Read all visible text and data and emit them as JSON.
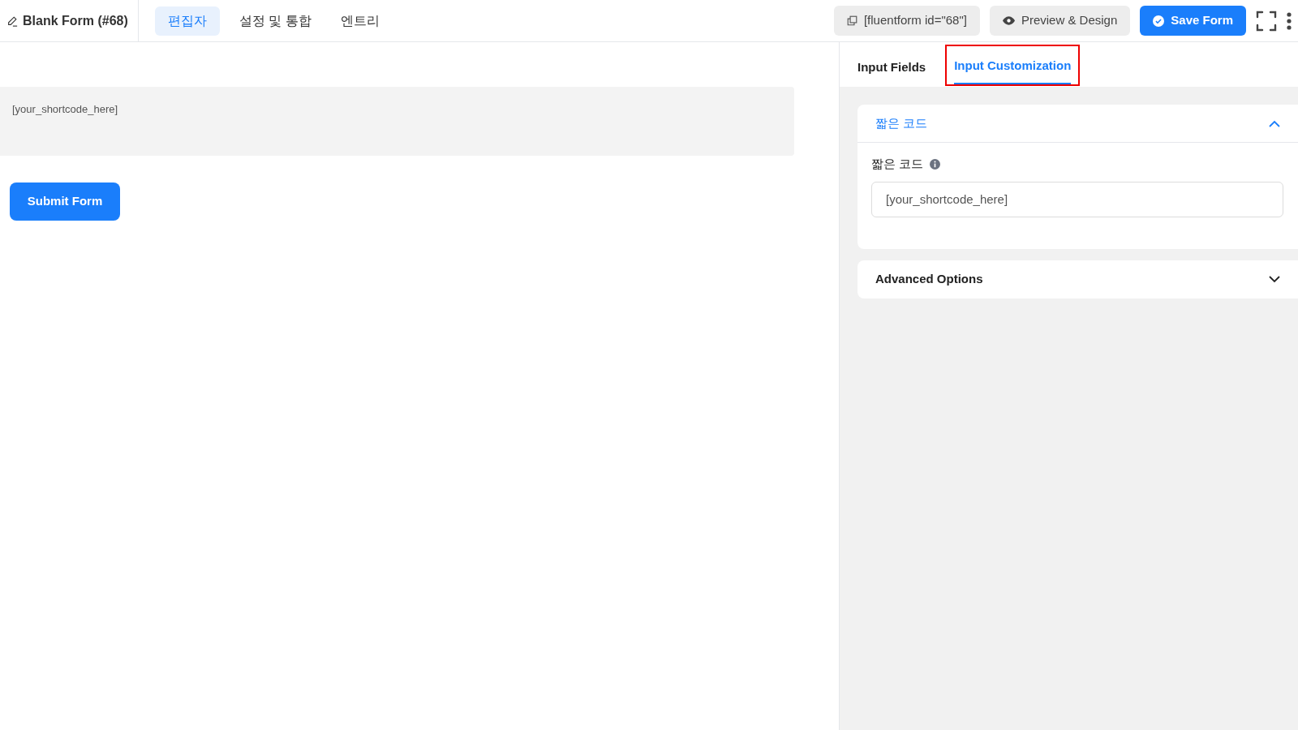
{
  "header": {
    "title": "Blank Form (#68)",
    "nav_tabs": [
      {
        "label": "편집자",
        "selected": true
      },
      {
        "label": "설정 및 통합",
        "selected": false
      },
      {
        "label": "엔트리",
        "selected": false
      }
    ],
    "shortcode_button": "[fluentform id=\"68\"]",
    "preview_button": "Preview & Design",
    "save_button": "Save Form"
  },
  "canvas": {
    "shortcode_block": "[your_shortcode_here]",
    "submit_button": "Submit Form"
  },
  "sidebar": {
    "tabs": [
      {
        "label": "Input Fields",
        "selected": false,
        "highlighted": false
      },
      {
        "label": "Input Customization",
        "selected": true,
        "highlighted": true
      }
    ],
    "sections": [
      {
        "title": "짧은 코드",
        "expanded": true,
        "field_label": "짧은 코드",
        "field_value": "[your_shortcode_here]"
      },
      {
        "title": "Advanced Options",
        "expanded": false
      }
    ]
  }
}
